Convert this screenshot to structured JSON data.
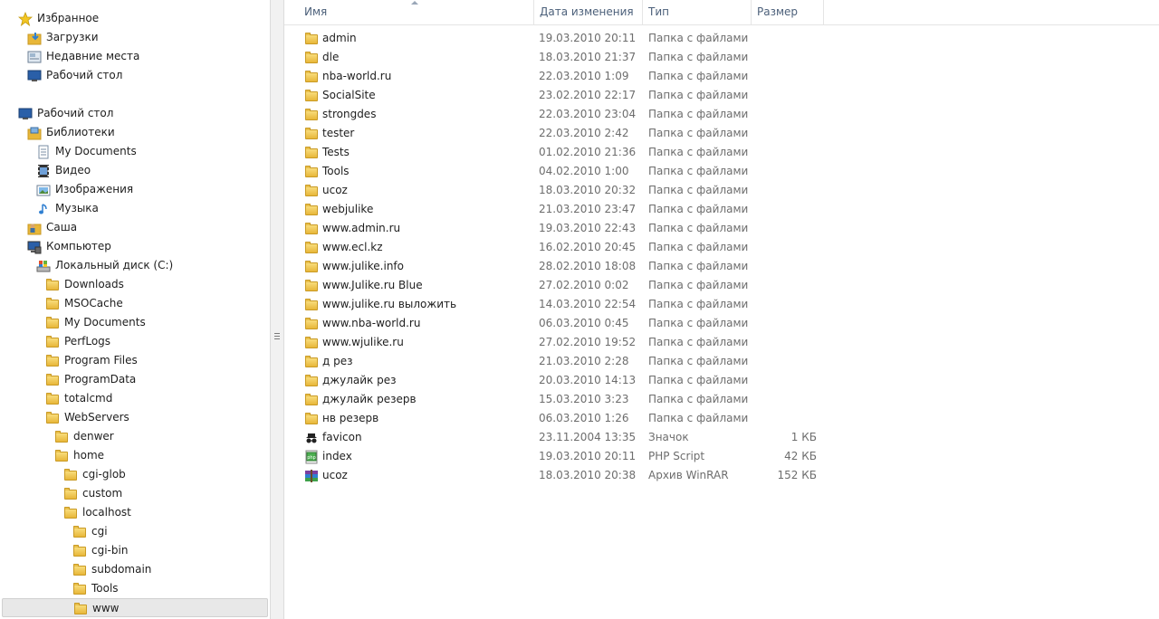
{
  "nav": {
    "favorites": {
      "label": "Избранное",
      "items": [
        "Загрузки",
        "Недавние места",
        "Рабочий стол"
      ]
    },
    "desktop": {
      "label": "Рабочий стол"
    },
    "libraries": {
      "label": "Библиотеки",
      "items": [
        "My Documents",
        "Видео",
        "Изображения",
        "Музыка"
      ]
    },
    "user": {
      "label": "Саша"
    },
    "computer": {
      "label": "Компьютер"
    },
    "drive": {
      "label": "Локальный диск (C:)"
    },
    "drive_folders": [
      "Downloads",
      "MSOCache",
      "My Documents",
      "PerfLogs",
      "Program Files",
      "ProgramData",
      "totalcmd",
      "WebServers"
    ],
    "webservers": [
      "denwer",
      "home"
    ],
    "home": [
      "cgi-glob",
      "custom",
      "localhost"
    ],
    "localhost": [
      "cgi",
      "cgi-bin",
      "subdomain",
      "Tools",
      "www"
    ]
  },
  "columns": {
    "name": "Имя",
    "date": "Дата изменения",
    "type": "Тип",
    "size": "Размер"
  },
  "files": [
    {
      "name": "admin",
      "date": "19.03.2010 20:11",
      "type": "Папка с файлами",
      "size": "",
      "icon": "folder-icon"
    },
    {
      "name": "dle",
      "date": "18.03.2010 21:37",
      "type": "Папка с файлами",
      "size": "",
      "icon": "folder-icon"
    },
    {
      "name": "nba-world.ru",
      "date": "22.03.2010 1:09",
      "type": "Папка с файлами",
      "size": "",
      "icon": "folder-icon"
    },
    {
      "name": "SocialSite",
      "date": "23.02.2010 22:17",
      "type": "Папка с файлами",
      "size": "",
      "icon": "folder-icon"
    },
    {
      "name": "strongdes",
      "date": "22.03.2010 23:04",
      "type": "Папка с файлами",
      "size": "",
      "icon": "folder-icon"
    },
    {
      "name": "tester",
      "date": "22.03.2010 2:42",
      "type": "Папка с файлами",
      "size": "",
      "icon": "folder-icon"
    },
    {
      "name": "Tests",
      "date": "01.02.2010 21:36",
      "type": "Папка с файлами",
      "size": "",
      "icon": "folder-icon"
    },
    {
      "name": "Tools",
      "date": "04.02.2010 1:00",
      "type": "Папка с файлами",
      "size": "",
      "icon": "folder-icon"
    },
    {
      "name": "ucoz",
      "date": "18.03.2010 20:32",
      "type": "Папка с файлами",
      "size": "",
      "icon": "folder-icon"
    },
    {
      "name": "webjulike",
      "date": "21.03.2010 23:47",
      "type": "Папка с файлами",
      "size": "",
      "icon": "folder-icon"
    },
    {
      "name": "www.admin.ru",
      "date": "19.03.2010 22:43",
      "type": "Папка с файлами",
      "size": "",
      "icon": "folder-icon"
    },
    {
      "name": "www.ecl.kz",
      "date": "16.02.2010 20:45",
      "type": "Папка с файлами",
      "size": "",
      "icon": "folder-icon"
    },
    {
      "name": "www.julike.info",
      "date": "28.02.2010 18:08",
      "type": "Папка с файлами",
      "size": "",
      "icon": "folder-icon"
    },
    {
      "name": "www.Julike.ru Blue",
      "date": "27.02.2010 0:02",
      "type": "Папка с файлами",
      "size": "",
      "icon": "folder-icon"
    },
    {
      "name": "www.julike.ru выложить",
      "date": "14.03.2010 22:54",
      "type": "Папка с файлами",
      "size": "",
      "icon": "folder-icon"
    },
    {
      "name": "www.nba-world.ru",
      "date": "06.03.2010 0:45",
      "type": "Папка с файлами",
      "size": "",
      "icon": "folder-icon"
    },
    {
      "name": "www.wjulike.ru",
      "date": "27.02.2010 19:52",
      "type": "Папка с файлами",
      "size": "",
      "icon": "folder-icon"
    },
    {
      "name": "д рез",
      "date": "21.03.2010 2:28",
      "type": "Папка с файлами",
      "size": "",
      "icon": "folder-icon"
    },
    {
      "name": "джулайк рез",
      "date": "20.03.2010 14:13",
      "type": "Папка с файлами",
      "size": "",
      "icon": "folder-icon"
    },
    {
      "name": "джулайк резерв",
      "date": "15.03.2010 3:23",
      "type": "Папка с файлами",
      "size": "",
      "icon": "folder-icon"
    },
    {
      "name": "нв резерв",
      "date": "06.03.2010 1:26",
      "type": "Папка с файлами",
      "size": "",
      "icon": "folder-icon"
    },
    {
      "name": "favicon",
      "date": "23.11.2004 13:35",
      "type": "Значок",
      "size": "1 КБ",
      "icon": "spy-icon"
    },
    {
      "name": "index",
      "date": "19.03.2010 20:11",
      "type": "PHP Script",
      "size": "42 КБ",
      "icon": "php-script-icon"
    },
    {
      "name": "ucoz",
      "date": "18.03.2010 20:38",
      "type": "Архив WinRAR",
      "size": "152 КБ",
      "icon": "winrar-archive-icon"
    }
  ]
}
